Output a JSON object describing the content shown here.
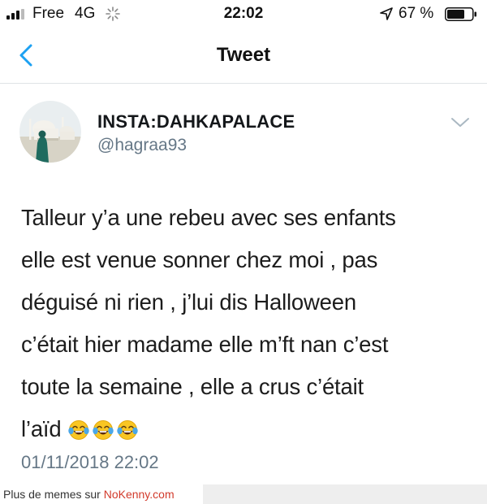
{
  "status_bar": {
    "carrier": "Free",
    "network": "4G",
    "time": "22:02",
    "battery_percent": "67 %",
    "icons": [
      "signal-bars-icon",
      "loading-spinner-icon",
      "location-arrow-icon",
      "battery-icon"
    ]
  },
  "nav": {
    "title": "Tweet",
    "back_icon": "chevron-left-icon"
  },
  "tweet": {
    "display_name": "INSTA:DAHKAPALACE",
    "handle": "@hagraa93",
    "text": "Talleur y’a une rebeu avec ses enfants\nelle est venue sonner chez moi , pas\ndéguisé ni rien , j’lui dis Halloween\nc’était hier madame elle m’ft nan c’est\ntoute la semaine , elle a crus c’était\nl’aïd",
    "emojis": [
      "tears-of-joy-emoji",
      "tears-of-joy-emoji",
      "tears-of-joy-emoji"
    ],
    "date": "01/11/2018 22:02",
    "menu_icon": "chevron-down-icon"
  },
  "footer": {
    "text": "Plus de memes sur ",
    "link": "NoKenny.com",
    "link_color": "#d23a2b"
  },
  "colors": {
    "accent": "#1da1f2",
    "secondary_text": "#657786"
  }
}
